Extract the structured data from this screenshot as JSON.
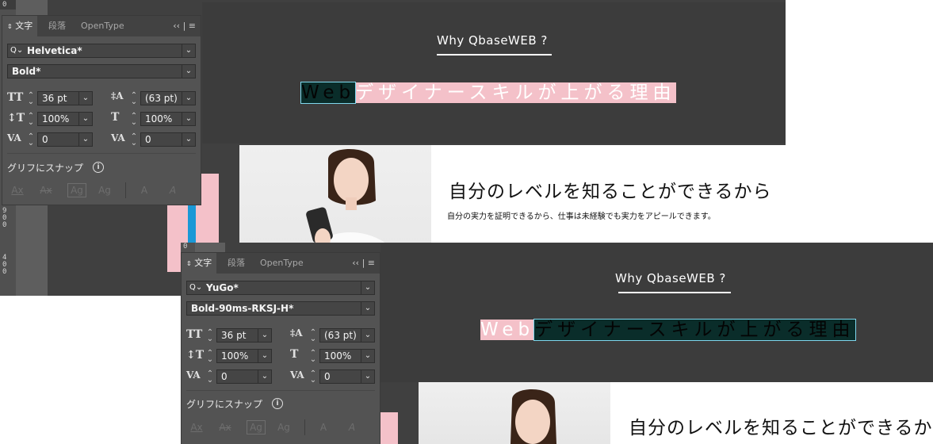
{
  "shots": [
    {
      "ruler_numbers": [
        "0",
        "9\n0\n0",
        "4\n0\n0"
      ],
      "artboard": {
        "why": "Why QbaseWEB ?",
        "headline_segments": [
          "Web",
          "デザイナースキルが上がる理由"
        ],
        "level_title": "自分のレベルを知ることができるから",
        "level_desc": "自分の実力を証明できるから、仕事は未経験でも実力をアピールできます。"
      },
      "panel": {
        "tab_active": "文字",
        "tab_2": "段落",
        "tab_3": "OpenType",
        "collapse": "‹‹",
        "menu": "≡",
        "font_family": "Helvetica*",
        "font_style": "Bold*",
        "size": "36 pt",
        "leading": "(63 pt)",
        "vscale": "100%",
        "hscale": "100%",
        "kerning": "0",
        "tracking": "0",
        "snap_label": "グリフにスナップ",
        "info": "i",
        "glyph_buttons": [
          "Ax",
          "Ax",
          "Ag",
          "Ag",
          "A",
          "A"
        ]
      }
    },
    {
      "ruler_numbers": [
        "0"
      ],
      "artboard": {
        "why": "Why QbaseWEB ?",
        "headline_segments": [
          "Web",
          "デザイナースキルが上がる理由"
        ],
        "level_title": "自分のレベルを知ることができるか"
      },
      "panel": {
        "tab_active": "文字",
        "tab_2": "段落",
        "tab_3": "OpenType",
        "collapse": "‹‹",
        "menu": "≡",
        "font_family": "YuGo*",
        "font_style": "Bold-90ms-RKSJ-H*",
        "size": "36 pt",
        "leading": "(63 pt)",
        "vscale": "100%",
        "hscale": "100%",
        "kerning": "0",
        "tracking": "0",
        "snap_label": "グリフにスナップ",
        "info": "i",
        "glyph_buttons": [
          "Ax",
          "Ax",
          "Ag",
          "Ag",
          "A",
          "A"
        ]
      }
    }
  ]
}
